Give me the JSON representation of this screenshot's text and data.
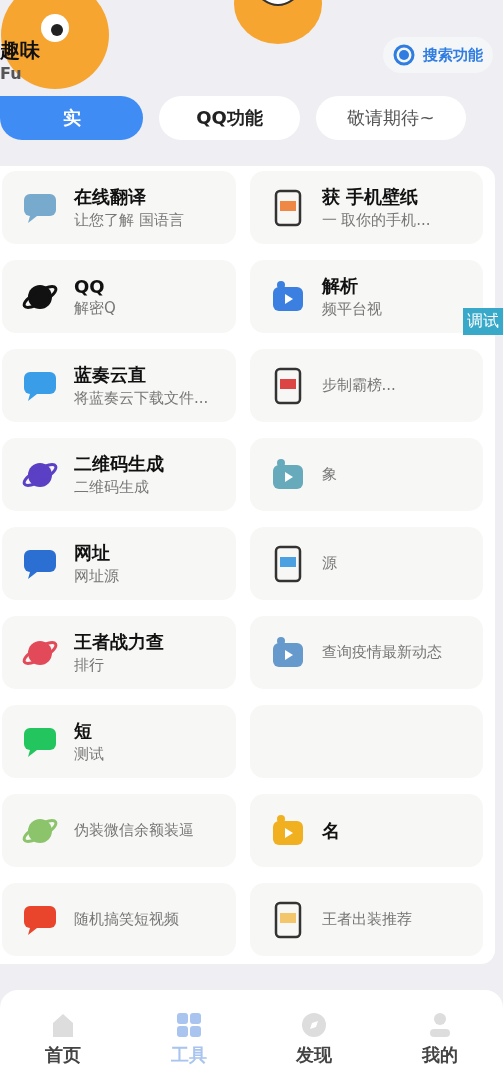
{
  "header": {
    "title": "趣味",
    "subtitle": "Fu",
    "search_button": "搜索功能"
  },
  "tabs": [
    {
      "label": "实",
      "selected": true
    },
    {
      "label": "QQ功能",
      "selected": false
    },
    {
      "label": "敬请期待~",
      "selected": false
    }
  ],
  "tools": [
    {
      "title": "在线翻译",
      "desc": "让您了解 国语言"
    },
    {
      "title": "获 手机壁纸",
      "desc": "一 取你的手机..."
    },
    {
      "title": "QQ",
      "desc": "解密Q"
    },
    {
      "title": "解析",
      "desc": "频平台视"
    },
    {
      "title": "蓝奏云直",
      "desc": "将蓝奏云下载文件..."
    },
    {
      "desc": "步制霸榜..."
    },
    {
      "title": "二维码生成",
      "desc": "二维码生成"
    },
    {
      "desc": "象"
    },
    {
      "title": "网址",
      "desc": "网址源"
    },
    {
      "desc": "源"
    },
    {
      "title": "王者战力查",
      "desc": "排行"
    },
    {
      "desc": "查询疫情最新动态"
    },
    {
      "title": "短",
      "desc": "测试"
    },
    {
      "kind": "redacted"
    },
    {
      "desc": "伪装微信余额装逼"
    },
    {
      "title": "名"
    },
    {
      "desc": "随机搞笑短视频"
    },
    {
      "desc": "王者出装推荐"
    }
  ],
  "debug_badge": "调试",
  "nav": [
    {
      "label": "首页",
      "selected": false
    },
    {
      "label": "工具",
      "selected": true
    },
    {
      "label": "发现",
      "selected": false
    },
    {
      "label": "我的",
      "selected": false
    }
  ]
}
